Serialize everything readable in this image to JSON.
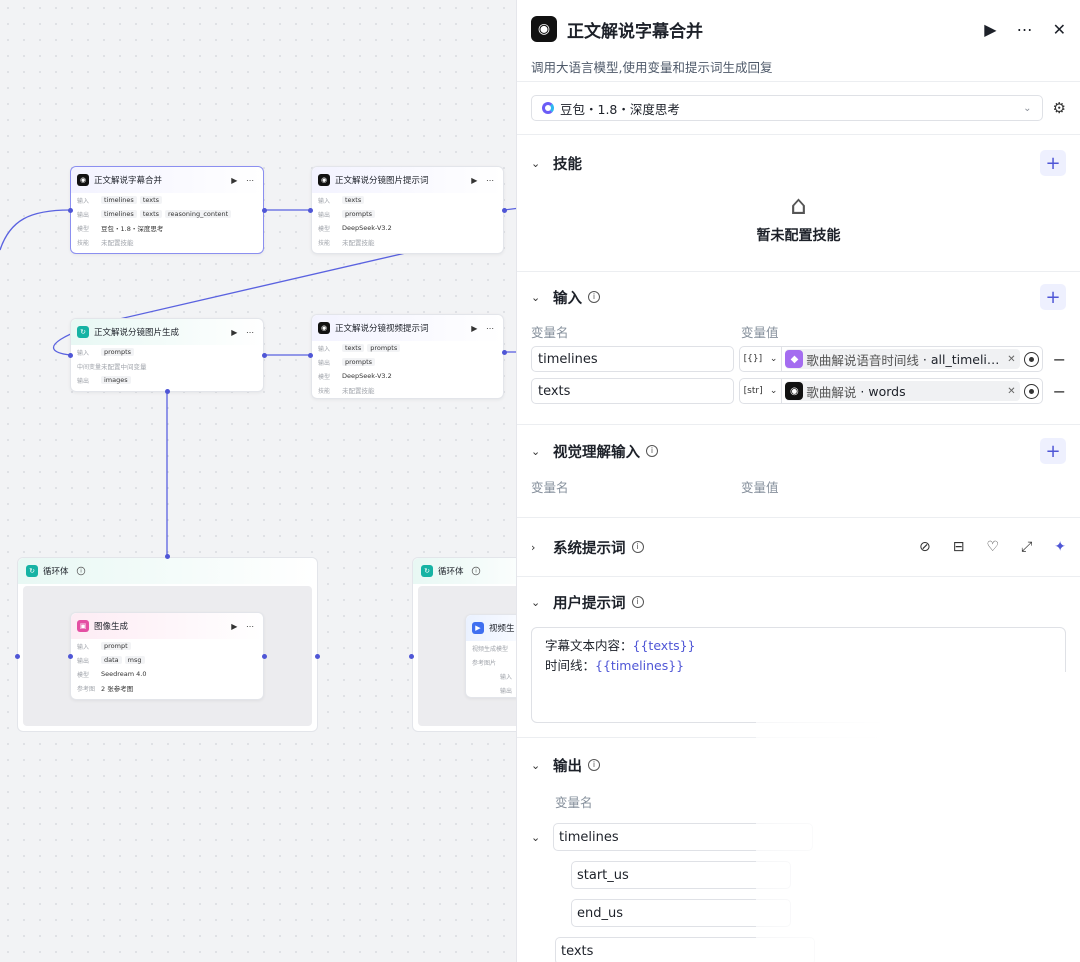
{
  "canvas": {
    "nodes": [
      {
        "title": "正文解说字幕合并",
        "rows": [
          {
            "label": "输入",
            "tags": [
              "timelines",
              "texts"
            ]
          },
          {
            "label": "输出",
            "tags": [
              "timelines",
              "texts",
              "reasoning_content"
            ]
          },
          {
            "label": "模型",
            "text": "豆包・1.8・深度思考"
          },
          {
            "label": "技能",
            "text": "未配置技能"
          }
        ]
      },
      {
        "title": "正文解说分镜图片提示词",
        "rows": [
          {
            "label": "输入",
            "tags": [
              "texts"
            ]
          },
          {
            "label": "输出",
            "tags": [
              "prompts"
            ]
          },
          {
            "label": "模型",
            "text": "DeepSeek-V3.2"
          },
          {
            "label": "技能",
            "text": "未配置技能"
          }
        ]
      },
      {
        "title": "正文解说分镜图片生成",
        "rows": [
          {
            "label": "输入",
            "tags": [
              "prompts"
            ]
          },
          {
            "label": "中间变量",
            "text": "未配置中间变量"
          },
          {
            "label": "输出",
            "tags": [
              "images"
            ]
          }
        ]
      },
      {
        "title": "正文解说分镜视频提示词",
        "rows": [
          {
            "label": "输入",
            "tags": [
              "texts",
              "prompts"
            ]
          },
          {
            "label": "输出",
            "tags": [
              "prompts"
            ]
          },
          {
            "label": "模型",
            "text": "DeepSeek-V3.2"
          },
          {
            "label": "技能",
            "text": "未配置技能"
          }
        ]
      },
      {
        "title": "图像生成",
        "rows": [
          {
            "label": "输入",
            "tags": [
              "prompt"
            ]
          },
          {
            "label": "输出",
            "tags": [
              "data",
              "msg"
            ]
          },
          {
            "label": "模型",
            "text": "Seedream 4.0"
          },
          {
            "label": "参考图",
            "text": "2 张参考图"
          }
        ]
      },
      {
        "title": "视频生",
        "rows": [
          {
            "label": "视频生成模型",
            "text": ""
          },
          {
            "label": "参考图片",
            "text": ""
          },
          {
            "label": "输入",
            "text": ""
          },
          {
            "label": "输出",
            "text": ""
          }
        ]
      }
    ],
    "loops": [
      {
        "title": "循环体"
      },
      {
        "title": "循环体"
      }
    ]
  },
  "panel": {
    "title": "正文解说字幕合并",
    "description": "调用大语言模型,使用变量和提示词生成回复",
    "model": "豆包・1.8・深度思考",
    "skills": {
      "title": "技能",
      "empty": "暂未配置技能"
    },
    "input": {
      "title": "输入",
      "col_name": "变量名",
      "col_value": "变量值",
      "rows": [
        {
          "name": "timelines",
          "type": "[{}]",
          "source": "歌曲解说语音时间线",
          "field": "all_timeli…"
        },
        {
          "name": "texts",
          "type": "[str]",
          "source": "歌曲解说",
          "field": "words"
        }
      ]
    },
    "visual_input": {
      "title": "视觉理解输入",
      "col_name": "变量名",
      "col_value": "变量值"
    },
    "system_prompt": {
      "title": "系统提示词"
    },
    "user_prompt": {
      "title": "用户提示词",
      "line1_label": "字幕文本内容：",
      "line1_var": "{{texts}}",
      "line2_label": "时间线：",
      "line2_var": "{{timelines}}"
    },
    "output": {
      "title": "输出",
      "col_name": "变量名",
      "fields": [
        "timelines",
        "start_us",
        "end_us",
        "texts"
      ]
    }
  },
  "colors": {
    "accent": "#4f56d6",
    "teal": "#16b3a4",
    "pink": "#e44fa3",
    "purple_chip": "#a46cf0"
  }
}
